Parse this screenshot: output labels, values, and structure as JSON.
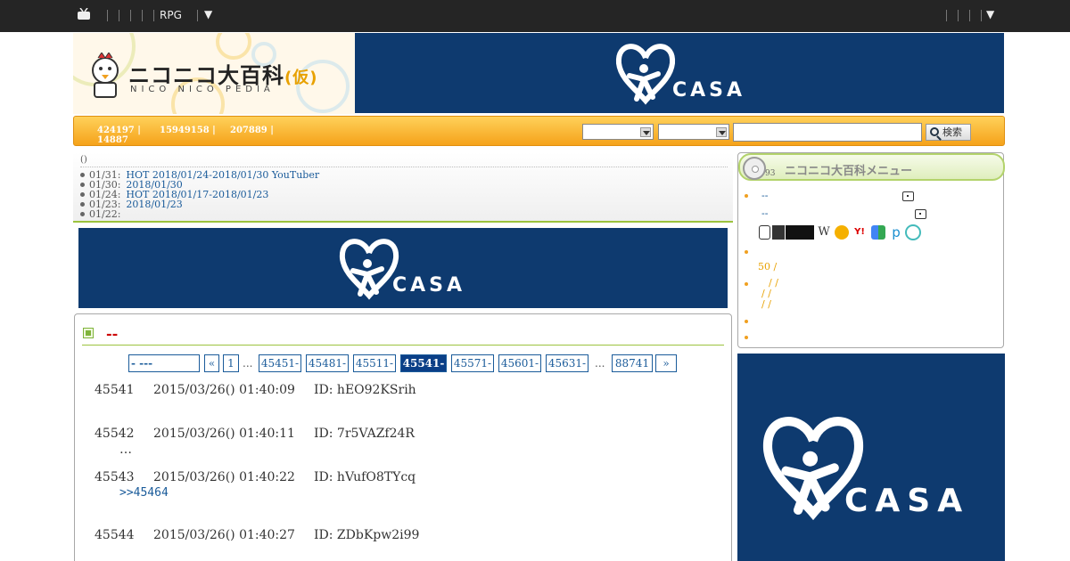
{
  "topbar": {
    "menu_label": "RPG",
    "left_caret": "▼",
    "right_caret": "▼"
  },
  "header": {
    "logo_title": "ニコニコ大百科",
    "logo_kari": "(仮)",
    "logo_sub": "NICO NICO PEDIA",
    "ad_word": "CASA"
  },
  "stats": {
    "s1": "424197 |",
    "s2": "14887",
    "s3": "15949158 |",
    "s4": "207889 |"
  },
  "search": {
    "button_label": "検索"
  },
  "news": {
    "heading": "()",
    "items": [
      {
        "date": "01/31:",
        "text": "HOT 2018/01/24-2018/01/30 YouTuber"
      },
      {
        "date": "01/30:",
        "text": "2018/01/30"
      },
      {
        "date": "01/24:",
        "text": "HOT 2018/01/17-2018/01/23"
      },
      {
        "date": "01/23:",
        "text": "2018/01/23"
      },
      {
        "date": "01/22:",
        "text": ""
      }
    ]
  },
  "ad2": {
    "word": "CASA"
  },
  "article": {
    "title": "--",
    "pager": {
      "select_label": "- ---",
      "prev": "«",
      "first": "1",
      "ellipsis": "...",
      "pages": [
        "45451-",
        "45481-",
        "45511-",
        "45541-",
        "45571-",
        "45601-",
        "45631-"
      ],
      "current": "45541-",
      "last": "88741",
      "next": "»"
    },
    "responses": [
      {
        "num": "45541",
        "date": "2015/03/26() 01:40:09",
        "id": "ID: hEO92KSrih",
        "body": "",
        "anchor": ""
      },
      {
        "num": "45542",
        "date": "2015/03/26() 01:40:11",
        "id": "ID: 7r5VAZf24R",
        "body": "…",
        "anchor": ""
      },
      {
        "num": "45543",
        "date": "2015/03/26() 01:40:22",
        "id": "ID: hVufO8TYcq",
        "body": "",
        "anchor": ">>45464"
      },
      {
        "num": "45544",
        "date": "2015/03/26() 01:40:27",
        "id": "ID: ZDbKpw2i99",
        "body": "",
        "anchor": ""
      }
    ]
  },
  "side_menu": {
    "title": "ニコニコ大百科メニュー",
    "cd_sub": "93",
    "link1": "--",
    "link2": "--",
    "orange1": "50 /",
    "orange2": "/ /",
    "orange3": "/ /",
    "orange4": "/ /",
    "service_icons": [
      "W",
      "Y!",
      "p"
    ]
  },
  "ad3": {
    "word": "CASA"
  },
  "colors": {
    "topbar": "#252525",
    "casa_blue": "#0e3a6f",
    "accent_orange": "#f5a21a",
    "accent_green": "#9cc33e",
    "link_blue": "#1a5b9a",
    "title_red": "#cc0000"
  }
}
